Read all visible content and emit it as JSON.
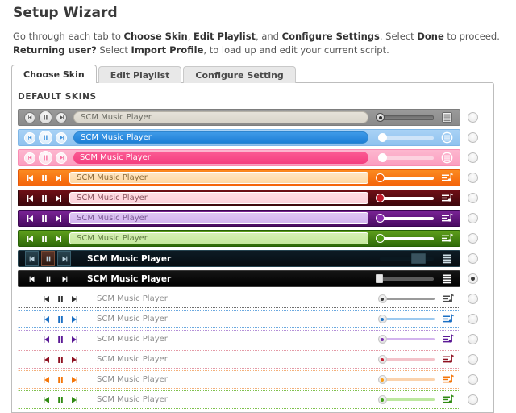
{
  "header": {
    "title": "Setup Wizard",
    "desc_line1_parts": [
      "Go through each tab to ",
      "Choose Skin",
      ", ",
      "Edit Playlist",
      ", and ",
      "Configure Settings",
      ". Select ",
      "Done",
      " to proceed."
    ],
    "desc_line2_parts": [
      "Returning user?",
      " Select ",
      "Import Profile",
      ", to load up and edit your current script."
    ]
  },
  "tabs": [
    {
      "label": "Choose Skin",
      "active": true
    },
    {
      "label": "Edit Playlist",
      "active": false
    },
    {
      "label": "Configure Setting",
      "active": false
    }
  ],
  "panel": {
    "section_label": "DEFAULT SKINS"
  },
  "player_title": "SCM Music Player",
  "icons": {
    "prev": "previous-track-icon",
    "pause": "pause-icon",
    "next": "next-track-icon",
    "playlist": "playlist-icon",
    "volume": "volume-slider"
  },
  "skins": [
    {
      "name": "grey",
      "style": "round",
      "selected": false,
      "bar_bg": "linear-gradient(#9a9a9a,#8a8a8a)",
      "bar_border": "#7d7d7d",
      "title_bg": "linear-gradient(#e6e2d9,#d8d4ca)",
      "title_color": "#6b6b63",
      "title_border": "#b6b2a8",
      "btn_face": "radial-gradient(circle at 50% 30%,#fbfbfb,#d2d2d2)",
      "btn_border": "#7a7a7a",
      "glyph": "#555555",
      "track": "linear-gradient(#6f6f6f,#888)",
      "knob": "radial-gradient(circle at 50% 30%,#f2f2f2,#bdbdbd)",
      "knob_border": "#4d4d4d",
      "knob_dot": "#2b2b2b",
      "pl_color": "#e8e8e8",
      "pl_shape": "box",
      "pl_box_bg": "linear-gradient(#f0f0f0,#cfcfcf)",
      "pl_line": "#6a6a6a",
      "knob_pct": 2
    },
    {
      "name": "blue",
      "style": "round",
      "selected": false,
      "bar_bg": "linear-gradient(#a9d2f5,#8fc2ef)",
      "bar_border": "#7fb6e6",
      "title_bg": "linear-gradient(#3e9ae8,#1d7fd6)",
      "title_color": "#ffffff",
      "title_border": "#2e86cf",
      "btn_face": "radial-gradient(circle at 50% 30%,#ffffff,#cfe6fa)",
      "btn_border": "#ffffff",
      "glyph": "#3f93dd",
      "track": "#cfe4f8",
      "knob": "#ffffff",
      "knob_border": "#ffffff",
      "knob_dot": "",
      "pl_color": "#ffffff",
      "pl_shape": "circle",
      "pl_box_bg": "",
      "pl_line": "#ffffff",
      "knob_pct": 6
    },
    {
      "name": "pink",
      "style": "round",
      "selected": false,
      "bar_bg": "linear-gradient(#fdb7cf,#fb9ec0)",
      "bar_border": "#f98db3",
      "title_bg": "linear-gradient(#fb5b93,#f43d7f)",
      "title_color": "#ffffff",
      "title_border": "#f2vertical",
      "btn_face": "radial-gradient(circle at 50% 30%,#ffffff,#fcd7e4)",
      "btn_border": "#ffffff",
      "glyph": "#f76fa0",
      "track": "#fcd2e0",
      "knob": "#ffffff",
      "knob_border": "#ffffff",
      "knob_dot": "",
      "pl_color": "#ffffff",
      "pl_shape": "circle",
      "pl_box_bg": "",
      "pl_line": "#ffffff",
      "knob_pct": 6
    },
    {
      "name": "orange",
      "style": "flat",
      "selected": false,
      "bar_bg": "linear-gradient(#fb8a20,#f4640a)",
      "bar_border": "#e2560a",
      "title_bg": "linear-gradient(#ffe7c4,#ffd9a3)",
      "title_color": "#8a6a3a",
      "title_border": "#ffffff",
      "btn_face": "",
      "btn_border": "",
      "glyph": "#ffffff",
      "track": "#ffffff",
      "knob": "#f4640a",
      "knob_border": "#ffffff",
      "knob_dot": "",
      "pl_color": "#ffffff",
      "pl_shape": "note",
      "pl_box_bg": "",
      "pl_line": "#ffffff",
      "knob_pct": 2
    },
    {
      "name": "darkred",
      "style": "flat",
      "selected": false,
      "bar_bg": "linear-gradient(#6e0f16,#3d070c)",
      "bar_border": "#2b0509",
      "title_bg": "linear-gradient(#ffdee4,#fcd0d9)",
      "title_color": "#8a5560",
      "title_border": "#ffffff",
      "btn_face": "",
      "btn_border": "",
      "glyph": "#ffffff",
      "track": "#ffffff",
      "knob": "#c01a2a",
      "knob_border": "#ffffff",
      "knob_dot": "",
      "pl_color": "#ffffff",
      "pl_shape": "note",
      "pl_box_bg": "",
      "pl_line": "#ffffff",
      "knob_pct": 2
    },
    {
      "name": "purple",
      "style": "flat",
      "selected": false,
      "bar_bg": "linear-gradient(#7a2496,#4a0b63)",
      "bar_border": "#3a0750",
      "title_bg": "linear-gradient(#dfc6f5,#d2b3ef)",
      "title_color": "#7a5a94",
      "title_border": "#ffffff",
      "btn_face": "",
      "btn_border": "",
      "glyph": "#ffffff",
      "track": "#ffffff",
      "knob": "#8a2dae",
      "knob_border": "#ffffff",
      "knob_dot": "",
      "pl_color": "#ffffff",
      "pl_shape": "note",
      "pl_box_bg": "",
      "pl_line": "#ffffff",
      "knob_pct": 2
    },
    {
      "name": "green",
      "style": "flat",
      "selected": false,
      "bar_bg": "linear-gradient(#5e9e1c,#2f6b09)",
      "bar_border": "#276007",
      "title_bg": "linear-gradient(#d6f0b4,#c6e89e)",
      "title_color": "#5f7a42",
      "title_border": "#ffffff",
      "btn_face": "",
      "btn_border": "",
      "glyph": "#ffffff",
      "track": "#ffffff",
      "knob": "#4e9a12",
      "knob_border": "#ffffff",
      "knob_dot": "",
      "pl_color": "#ffffff",
      "pl_shape": "note",
      "pl_box_bg": "",
      "pl_line": "#ffffff",
      "knob_pct": 2
    },
    {
      "name": "darkslate",
      "style": "dark",
      "selected": false,
      "bar_bg": "linear-gradient(#0d1b24,#060d12)",
      "bar_border": "#25434f",
      "title_bg": "transparent",
      "title_color": "#ffffff",
      "title_border": "transparent",
      "btn_face": "linear-gradient(#2a4450,#13242c)",
      "btn_border": "#3a5e6d",
      "glyph": "#b8cfdb",
      "track": "#0a1820",
      "knob": "#39525e",
      "knob_border": "#2b454f",
      "knob_dot": "",
      "pl_color": "#cfe0e8",
      "pl_shape": "bars",
      "pl_box_bg": "linear-gradient(#15303c,#0c1c24)",
      "pl_line": "#cfe0e8",
      "knob_pct": 62
    },
    {
      "name": "black",
      "style": "dark",
      "selected": true,
      "bar_bg": "linear-gradient(#151515,#000000)",
      "bar_border": "#3a3a3a",
      "title_bg": "transparent",
      "title_color": "#ffffff",
      "title_border": "transparent",
      "btn_face": "",
      "btn_border": "",
      "glyph": "#ffffff",
      "track": "#5a5a5a",
      "knob": "#e8e8e8",
      "knob_border": "#cfcfcf",
      "knob_dot": "",
      "pl_color": "#ffffff",
      "pl_shape": "bars",
      "pl_box_bg": "",
      "pl_line": "#ffffff",
      "knob_pct": 2
    },
    {
      "name": "light-grey",
      "style": "light",
      "selected": false,
      "bar_bg": "transparent",
      "bar_border": "#6e6e6e",
      "title_bg": "transparent",
      "title_color": "#8c8c8c",
      "title_border": "transparent",
      "btn_face": "",
      "btn_border": "",
      "glyph": "#2f2f2f",
      "track": "#9a9a9a",
      "knob": "radial-gradient(circle at 50% 30%,#f7f7f7,#d8d8d8)",
      "knob_border": "#c8c8c8",
      "knob_dot": "#3a3a3a",
      "pl_color": "#4a4a4a",
      "pl_shape": "note",
      "pl_box_bg": "",
      "pl_line": "#4a4a4a",
      "knob_pct": 4
    },
    {
      "name": "light-blue",
      "style": "light",
      "selected": false,
      "bar_bg": "transparent",
      "bar_border": "#6aa9e0",
      "title_bg": "transparent",
      "title_color": "#8c8c8c",
      "title_border": "transparent",
      "btn_face": "",
      "btn_border": "",
      "glyph": "#1a6fc4",
      "track": "#9dcaf0",
      "knob": "radial-gradient(circle at 50% 30%,#f7f7f7,#d8d8d8)",
      "knob_border": "#c8c8c8",
      "knob_dot": "#1a6fc4",
      "pl_color": "#1a6fc4",
      "pl_shape": "note",
      "pl_box_bg": "",
      "pl_line": "#1a6fc4",
      "knob_pct": 4
    },
    {
      "name": "light-purple",
      "style": "light",
      "selected": false,
      "bar_bg": "transparent",
      "bar_border": "#b48fd8",
      "title_bg": "transparent",
      "title_color": "#8c8c8c",
      "title_border": "transparent",
      "btn_face": "",
      "btn_border": "",
      "glyph": "#5b1a96",
      "track": "#d3b4ee",
      "knob": "radial-gradient(circle at 50% 30%,#f7f7f7,#d8d8d8)",
      "knob_border": "#c8c8c8",
      "knob_dot": "#7a2dae",
      "pl_color": "#5b1a96",
      "pl_shape": "note",
      "pl_box_bg": "",
      "pl_line": "#5b1a96",
      "knob_pct": 4
    },
    {
      "name": "light-red",
      "style": "light",
      "selected": false,
      "bar_bg": "transparent",
      "bar_border": "#e49aa6",
      "title_bg": "transparent",
      "title_color": "#8c8c8c",
      "title_border": "transparent",
      "btn_face": "",
      "btn_border": "",
      "glyph": "#8e1020",
      "track": "#f3c3ca",
      "knob": "radial-gradient(circle at 50% 30%,#f7f7f7,#d8d8d8)",
      "knob_border": "#c8c8c8",
      "knob_dot": "#c41f2f",
      "pl_color": "#8e1020",
      "pl_shape": "note",
      "pl_box_bg": "",
      "pl_line": "#8e1020",
      "knob_pct": 4
    },
    {
      "name": "light-orange",
      "style": "light",
      "selected": false,
      "bar_bg": "transparent",
      "bar_border": "#f4b07a",
      "title_bg": "transparent",
      "title_color": "#8c8c8c",
      "title_border": "transparent",
      "btn_face": "",
      "btn_border": "",
      "glyph": "#f4760a",
      "track": "#fbd3ad",
      "knob": "radial-gradient(circle at 50% 30%,#f7f7f7,#d8d8d8)",
      "knob_border": "#c8c8c8",
      "knob_dot": "#f99a12",
      "pl_color": "#f4760a",
      "pl_shape": "note",
      "pl_box_bg": "",
      "pl_line": "#f4760a",
      "knob_pct": 4
    },
    {
      "name": "light-green",
      "style": "light",
      "selected": false,
      "bar_bg": "transparent",
      "bar_border": "#7fc24e",
      "title_bg": "transparent",
      "title_color": "#8c8c8c",
      "title_border": "transparent",
      "btn_face": "",
      "btn_border": "",
      "glyph": "#2f8a12",
      "track": "#bde8a0",
      "knob": "radial-gradient(circle at 50% 30%,#f7f7f7,#d8d8d8)",
      "knob_border": "#c8c8c8",
      "knob_dot": "#3da017",
      "pl_color": "#2f8a12",
      "pl_shape": "note",
      "pl_box_bg": "",
      "pl_line": "#2f8a12",
      "knob_pct": 4
    }
  ]
}
